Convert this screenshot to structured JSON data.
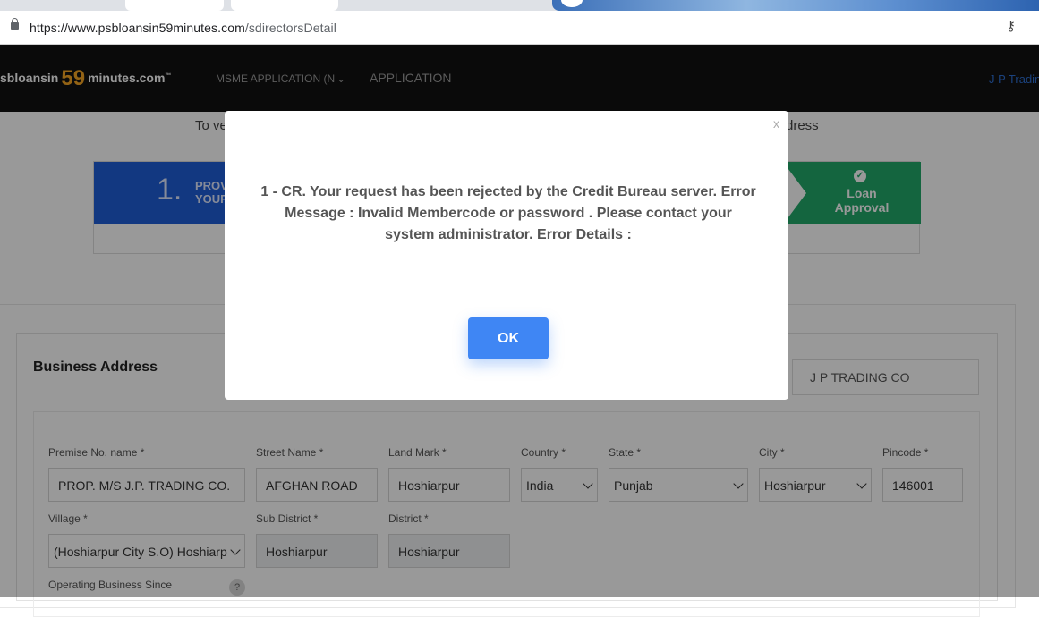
{
  "browser": {
    "url_host": "https://www.psbloansin59minutes.com",
    "url_path": "/sdirectorsDetail"
  },
  "site": {
    "logo_pre": "sbloansin",
    "logo_num": "59",
    "logo_post": "minutes.com",
    "logo_tm": "™",
    "nav_items": [
      "MSME APPLICATION (N",
      "APPLICATION"
    ],
    "user_name": "J P Tradin",
    "verify_text_start": "To ve",
    "verify_text_end": "dress",
    "step1_number": "1.",
    "step1_line1": "PROV",
    "step1_line2": "YOUR",
    "step_final_label": "Loan Approval"
  },
  "form": {
    "section_title": "Business Address",
    "company_name": "J P TRADING CO",
    "fields": {
      "premise": {
        "label": "Premise No. name *",
        "value": "PROP. M/S  J.P. TRADING CO."
      },
      "street": {
        "label": "Street Name *",
        "value": "AFGHAN ROAD"
      },
      "landmark": {
        "label": "Land Mark *",
        "value": "Hoshiarpur"
      },
      "country": {
        "label": "Country *",
        "value": "India"
      },
      "state": {
        "label": "State *",
        "value": "Punjab"
      },
      "city": {
        "label": "City *",
        "value": "Hoshiarpur"
      },
      "pincode": {
        "label": "Pincode *",
        "value": "146001"
      },
      "village": {
        "label": "Village *",
        "value": "(Hoshiarpur City S.O) Hoshiarp"
      },
      "subdistrict": {
        "label": "Sub District *",
        "value": "Hoshiarpur"
      },
      "district": {
        "label": "District *",
        "value": "Hoshiarpur"
      },
      "operating_since": {
        "label": "Operating Business Since"
      }
    },
    "help_icon": "?"
  },
  "modal": {
    "close_label": "x",
    "message": "1 - CR. Your request has been rejected by the Credit Bureau server. Error Message : Invalid Membercode or password . Please contact your system administrator. Error Details :",
    "ok_label": "OK"
  },
  "colors": {
    "primary_button": "#3f86f4",
    "step_blue": "#1f5ed8",
    "step_green": "#22a86a",
    "logo_accent": "#f5a623"
  }
}
